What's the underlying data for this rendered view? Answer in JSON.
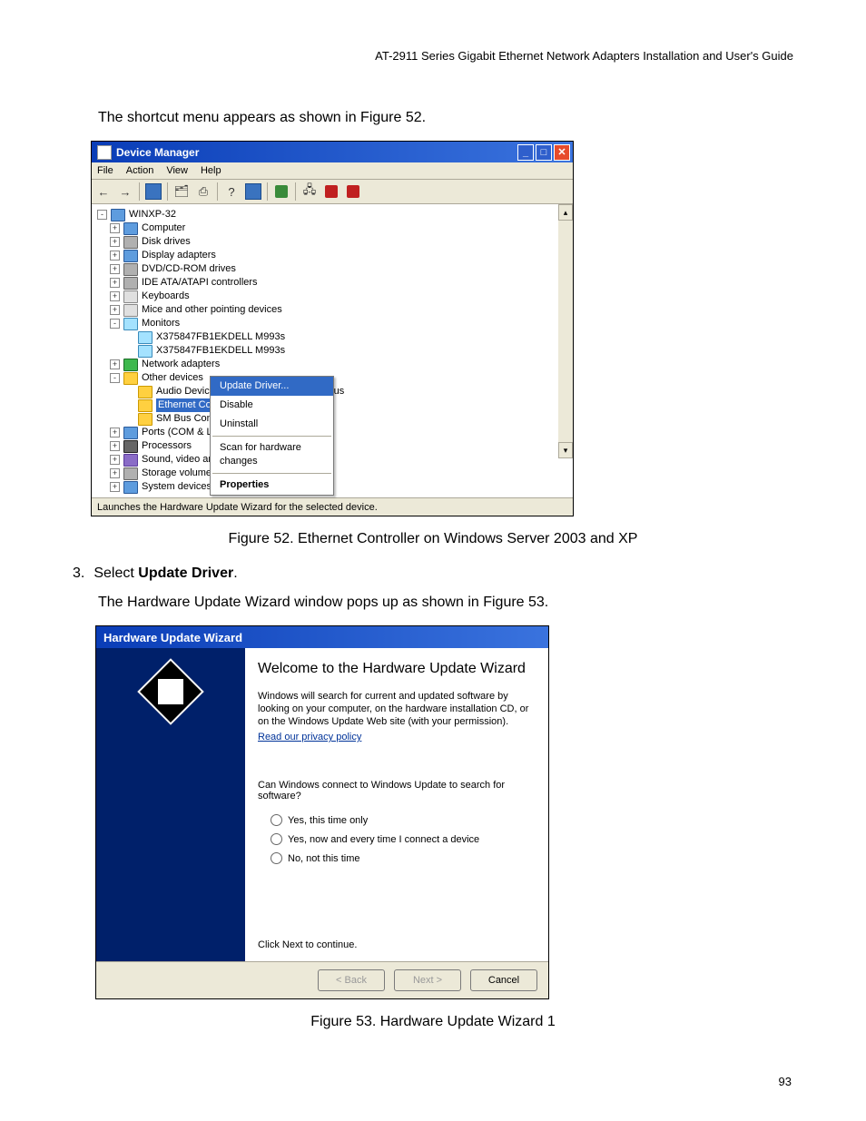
{
  "header": "AT-2911 Series Gigabit Ethernet Network Adapters Installation and User's Guide",
  "intro_text": "The shortcut menu appears as shown in Figure 52.",
  "devmgr": {
    "title": "Device Manager",
    "menus": {
      "file": "File",
      "action": "Action",
      "view": "View",
      "help": "Help"
    },
    "root": "WINXP-32",
    "nodes": {
      "computer": "Computer",
      "disk": "Disk drives",
      "display": "Display adapters",
      "dvd": "DVD/CD-ROM drives",
      "ide": "IDE ATA/ATAPI controllers",
      "keyboards": "Keyboards",
      "mice": "Mice and other pointing devices",
      "monitors": "Monitors",
      "monitor_item": "X375847FB1EKDELL M993s",
      "network": "Network adapters",
      "other": "Other devices",
      "audio": "Audio Device on High Definition Audio Bus",
      "ethernet_sel": "Ethernet Cont",
      "smbus": "SM Bus Contr",
      "ports": "Ports (COM & LPT)",
      "processors": "Processors",
      "sound": "Sound, video and",
      "storage": "Storage volumes",
      "system": "System devices"
    },
    "ctx": {
      "update": "Update Driver...",
      "disable": "Disable",
      "uninstall": "Uninstall",
      "scan": "Scan for hardware changes",
      "properties": "Properties"
    },
    "status": "Launches the Hardware Update Wizard for the selected device."
  },
  "figure52_caption": "Figure 52. Ethernet Controller on Windows Server 2003 and XP",
  "step3_num": "3.",
  "step3_text_pre": "Select ",
  "step3_bold": "Update Driver",
  "step3_text_post": ".",
  "after_step3": "The Hardware Update Wizard window pops up as shown in Figure 53.",
  "wizard": {
    "title": "Hardware Update Wizard",
    "heading": "Welcome to the Hardware Update Wizard",
    "para": "Windows will search for current and updated software by looking on your computer, on the hardware installation CD, or on the Windows Update Web site (with your permission).",
    "privacy": "Read our privacy policy",
    "question": "Can Windows connect to Windows Update to search for software?",
    "opt1": "Yes, this time only",
    "opt2": "Yes, now and every time I connect a device",
    "opt3": "No, not this time",
    "continue": "Click Next to continue.",
    "back": "< Back",
    "next": "Next >",
    "cancel": "Cancel"
  },
  "figure53_caption": "Figure 53. Hardware Update Wizard 1",
  "page_number": "93"
}
